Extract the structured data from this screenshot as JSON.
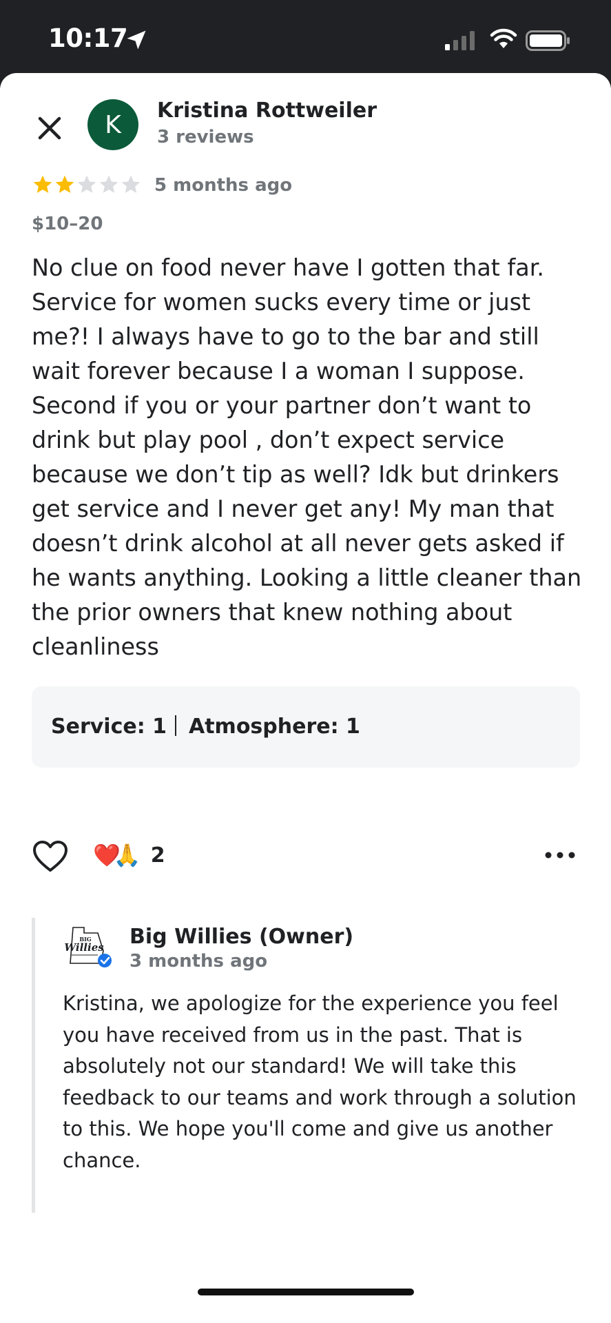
{
  "status_bar": {
    "time": "10:17"
  },
  "review": {
    "close_icon": "close-icon",
    "author": {
      "initial": "K",
      "avatar_color": "#0b5a3a",
      "name": "Kristina Rottweiler",
      "review_count": "3 reviews"
    },
    "rating": {
      "stars": 2,
      "max": 5
    },
    "date": "5 months ago",
    "price": "$10–20",
    "text": "No clue on food never have I gotten that far. Service for women sucks every time or just me?! I always have to go to the bar and still wait forever because I a woman I suppose. Second if you or your partner don’t want to drink but play pool , don’t expect service because we don’t tip as well? Idk but drinkers get service and I never get any! My man that doesn’t drink alcohol at all never gets asked if he wants anything. Looking a little cleaner than the prior owners that knew nothing about cleanliness",
    "attributes": [
      {
        "label": "Service: 1"
      },
      {
        "label": "Atmosphere: 1"
      }
    ],
    "reactions": {
      "emojis": [
        "❤️",
        "🙏"
      ],
      "count": "2"
    }
  },
  "owner_reply": {
    "logo_text": [
      "BIG",
      "Willies"
    ],
    "verified_color": "#1a73e8",
    "name": "Big Willies (Owner)",
    "date": "3 months ago",
    "text": "Kristina, we apologize for the experience you feel you have received from us in the past. That is absolutely not our standard! We will take this feedback to our teams and work through a solution to this. We hope you'll come and give us another chance."
  },
  "colors": {
    "star_filled": "#fbbc04",
    "star_empty": "#dadce0",
    "text_primary": "#202124",
    "text_secondary": "#70757a"
  }
}
